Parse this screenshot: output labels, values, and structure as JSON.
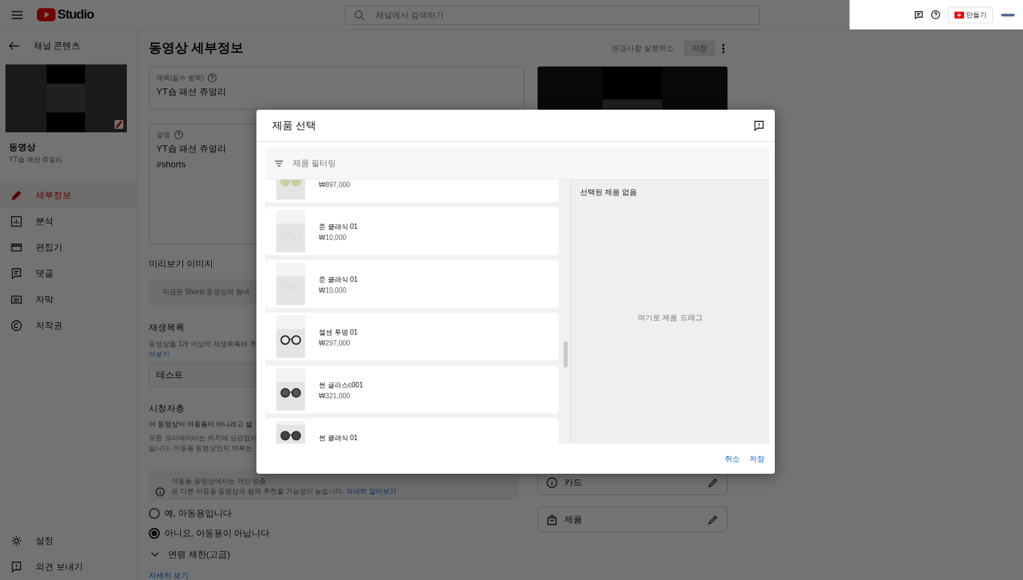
{
  "header": {
    "logo_text": "Studio",
    "search": {
      "placeholder": "채널에서 검색하기"
    },
    "create_button": "만들기"
  },
  "sidebar": {
    "back_label": "채널 콘텐츠",
    "video_label": "동영상",
    "video_title": "YT숍 패션 쥬얼리",
    "items": [
      {
        "label": "세부정보",
        "selected": true
      },
      {
        "label": "분석",
        "selected": false
      },
      {
        "label": "편집기",
        "selected": false
      },
      {
        "label": "댓글",
        "selected": false
      },
      {
        "label": "자막",
        "selected": false
      },
      {
        "label": "저작권",
        "selected": false
      }
    ],
    "bottom_items": [
      {
        "label": "설정"
      },
      {
        "label": "의견 보내기"
      }
    ]
  },
  "main": {
    "title": "동영상 세부정보",
    "undo_label": "변경사항 실행취소",
    "save_button": {
      "label": "저장",
      "disabled": true
    },
    "title_field": {
      "label": "제목(필수 항목)",
      "value": "YT숍 패션 쥬얼리"
    },
    "description_field": {
      "label": "설명",
      "lines": [
        "YT숍 패션 쥬얼리",
        "#shorts"
      ]
    },
    "thumbnail_section": {
      "heading": "미리보기 이미지",
      "info": "지금은 Shorts 동영상의 썸네"
    },
    "playlist_section": {
      "heading": "재생목록",
      "text": "동영상을 1개 이상의 재생목록에 추",
      "link": "아보기",
      "select_value": "테스트"
    },
    "audience_section": {
      "heading": "시청자층",
      "lines": [
        "이 동영상이 아동용이 아니라고 설",
        "모든 크리에이터는 위치에 상관없이",
        "습니다. 아동용 동영상인지 여부는"
      ],
      "info_lines": [
        "아동용 동영상에서는 개인 맞춤",
        "은 다른 아동용 동영상과 함께 추천될 가능성이 높습니다."
      ],
      "info_link": "자세히 알아보기",
      "options": [
        {
          "label": "예, 아동용입니다",
          "selected": false
        },
        {
          "label": "아니요, 아동용이 아닙니다",
          "selected": true
        }
      ]
    },
    "age_restriction": {
      "label": "연령 제한(고급)",
      "expanded": false
    },
    "more_link": "자세히 보기",
    "cards": [
      {
        "label": "카드"
      },
      {
        "label": "제품"
      }
    ]
  },
  "modal": {
    "title": "제품 선택",
    "filter_placeholder": "제품 필터링",
    "products": [
      {
        "price": "₩897,000"
      },
      {
        "name": "준 클래식 01",
        "price": "₩10,000"
      },
      {
        "name": "준 클래식 01",
        "price": "₩10,000"
      },
      {
        "name": "젤센 투명 01",
        "price": "₩297,000"
      },
      {
        "name": "썬 글라스c001",
        "price": "₩321,000"
      },
      {
        "name": "썬 클래식 01"
      }
    ],
    "selected_empty": "선택된 제품 없음",
    "drop_hint": "여기로 제품 드래그",
    "cancel": "취소",
    "save": "저장"
  }
}
